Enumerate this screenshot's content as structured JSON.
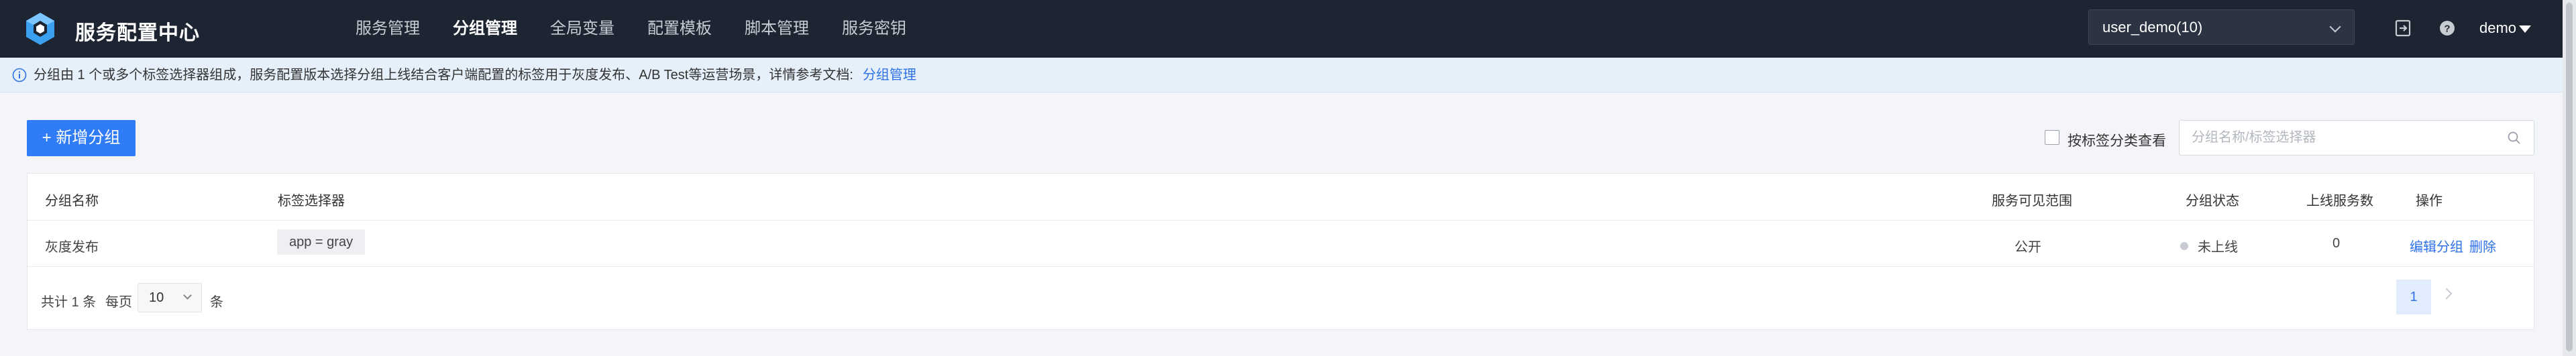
{
  "header": {
    "brand": "服务配置中心",
    "nav": [
      {
        "label": "服务管理",
        "active": false
      },
      {
        "label": "分组管理",
        "active": true
      },
      {
        "label": "全局变量",
        "active": false
      },
      {
        "label": "配置模板",
        "active": false
      },
      {
        "label": "脚本管理",
        "active": false
      },
      {
        "label": "服务密钥",
        "active": false
      }
    ],
    "namespace_select": "user_demo(10)",
    "user": "demo"
  },
  "notice": {
    "text": "分组由 1 个或多个标签选择器组成，服务配置版本选择分组上线结合客户端配置的标签用于灰度发布、A/B Test等运营场景，详情参考文档:",
    "link": "分组管理"
  },
  "toolbar": {
    "add_button": "+ 新增分组",
    "filter_label": "按标签分类查看",
    "search_placeholder": "分组名称/标签选择器"
  },
  "table": {
    "headers": [
      "分组名称",
      "标签选择器",
      "服务可见范围",
      "分组状态",
      "上线服务数",
      "操作"
    ],
    "rows": [
      {
        "name": "灰度发布",
        "selector": "app = gray",
        "scope": "公开",
        "status": "未上线",
        "online_count": "0",
        "edit": "编辑分组",
        "delete": "删除"
      }
    ]
  },
  "pagination": {
    "total": "共计 1 条",
    "per_page_label": "每页",
    "per_page_value": "10",
    "per_page_unit": "条",
    "current_page": "1"
  },
  "colors": {
    "topbar": "#1e2532",
    "primary": "#2f7cf6",
    "link": "#2f72e8",
    "notice_bg": "#e6f0fb"
  }
}
